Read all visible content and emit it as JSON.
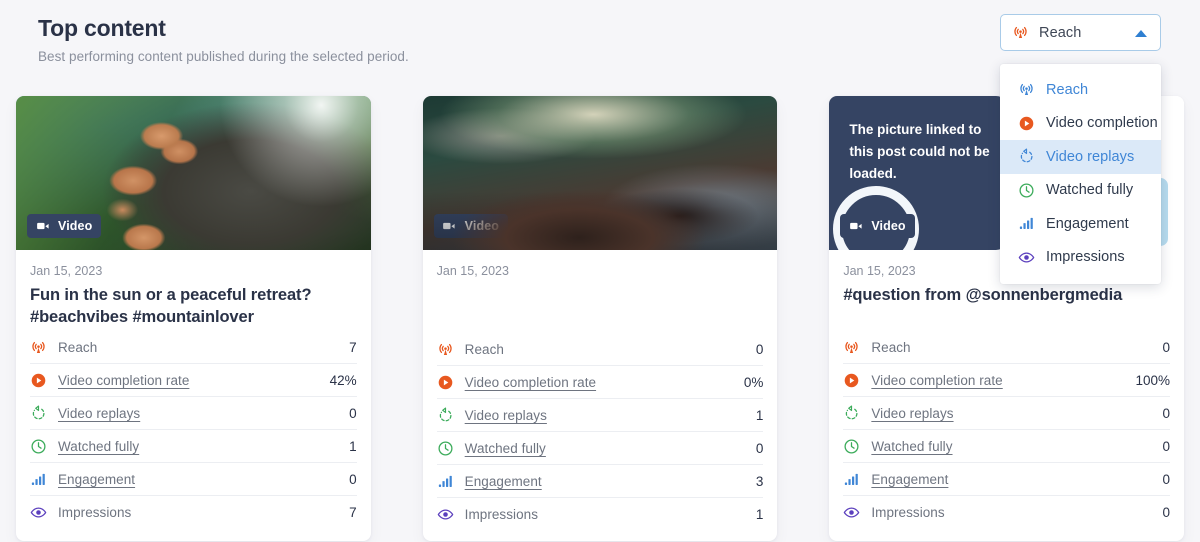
{
  "header": {
    "title": "Top content",
    "subtitle": "Best performing content published during the selected period."
  },
  "metric_select": {
    "selected_label": "Reach",
    "selected_icon": "broadcast-icon",
    "caret_icon": "chevron-up-icon",
    "expanded": true,
    "options": [
      {
        "label": "Reach",
        "icon": "broadcast-icon",
        "state": "selected"
      },
      {
        "label": "Video completion r",
        "icon": "play-circle-icon",
        "state": "normal"
      },
      {
        "label": "Video replays",
        "icon": "replay-icon",
        "state": "hovered"
      },
      {
        "label": "Watched fully",
        "icon": "clock-icon",
        "state": "normal"
      },
      {
        "label": "Engagement",
        "icon": "bar-chart-icon",
        "state": "normal"
      },
      {
        "label": "Impressions",
        "icon": "eye-icon",
        "state": "normal"
      }
    ]
  },
  "colors": {
    "page_background": "#f6f6f9",
    "card_background": "#ffffff",
    "title_text": "#2a3247",
    "muted_text": "#8b909d",
    "accent_blue": "#3f86d6",
    "highlight_row": "#dbe9f8",
    "orange": "#e8581f",
    "green": "#3bab5a",
    "purple": "#5b3fbd",
    "dark_panel": "#354463"
  },
  "cards": [
    {
      "thumb_kind": "palm-tree-photo",
      "badge": {
        "label": "Video",
        "icon": "video-camera-icon"
      },
      "date": "Jan 15, 2023",
      "title": "Fun in the sun or a peaceful retreat? #beachvibes #mountainlover",
      "metrics": [
        {
          "label": "Reach",
          "value": "7",
          "icon": "broadcast-icon",
          "link": false
        },
        {
          "label": "Video completion rate",
          "value": "42%",
          "icon": "play-circle-icon",
          "link": true
        },
        {
          "label": "Video replays",
          "value": "0",
          "icon": "replay-icon",
          "link": true
        },
        {
          "label": "Watched fully",
          "value": "1",
          "icon": "clock-icon",
          "link": true
        },
        {
          "label": "Engagement",
          "value": "0",
          "icon": "bar-chart-icon",
          "link": true
        },
        {
          "label": "Impressions",
          "value": "7",
          "icon": "eye-icon",
          "link": false
        }
      ]
    },
    {
      "thumb_kind": "aerial-ocean-photo",
      "badge": {
        "label": "Video",
        "icon": "video-camera-icon"
      },
      "date": "Jan 15, 2023",
      "title": "",
      "metrics": [
        {
          "label": "Reach",
          "value": "0",
          "icon": "broadcast-icon",
          "link": false
        },
        {
          "label": "Video completion rate",
          "value": "0%",
          "icon": "play-circle-icon",
          "link": true
        },
        {
          "label": "Video replays",
          "value": "1",
          "icon": "replay-icon",
          "link": true
        },
        {
          "label": "Watched fully",
          "value": "0",
          "icon": "clock-icon",
          "link": true
        },
        {
          "label": "Engagement",
          "value": "3",
          "icon": "bar-chart-icon",
          "link": true
        },
        {
          "label": "Impressions",
          "value": "1",
          "icon": "eye-icon",
          "link": false
        }
      ]
    },
    {
      "thumb_kind": "broken-image-placeholder",
      "broken_message": "The picture linked to this post could not be loaded.",
      "badge": {
        "label": "Video",
        "icon": "video-camera-icon"
      },
      "date": "Jan 15, 2023",
      "title": "#question from @sonnenbergmedia",
      "metrics": [
        {
          "label": "Reach",
          "value": "0",
          "icon": "broadcast-icon",
          "link": false
        },
        {
          "label": "Video completion rate",
          "value": "100%",
          "icon": "play-circle-icon",
          "link": true
        },
        {
          "label": "Video replays",
          "value": "0",
          "icon": "replay-icon",
          "link": true
        },
        {
          "label": "Watched fully",
          "value": "0",
          "icon": "clock-icon",
          "link": true
        },
        {
          "label": "Engagement",
          "value": "0",
          "icon": "bar-chart-icon",
          "link": true
        },
        {
          "label": "Impressions",
          "value": "0",
          "icon": "eye-icon",
          "link": false
        }
      ]
    }
  ]
}
